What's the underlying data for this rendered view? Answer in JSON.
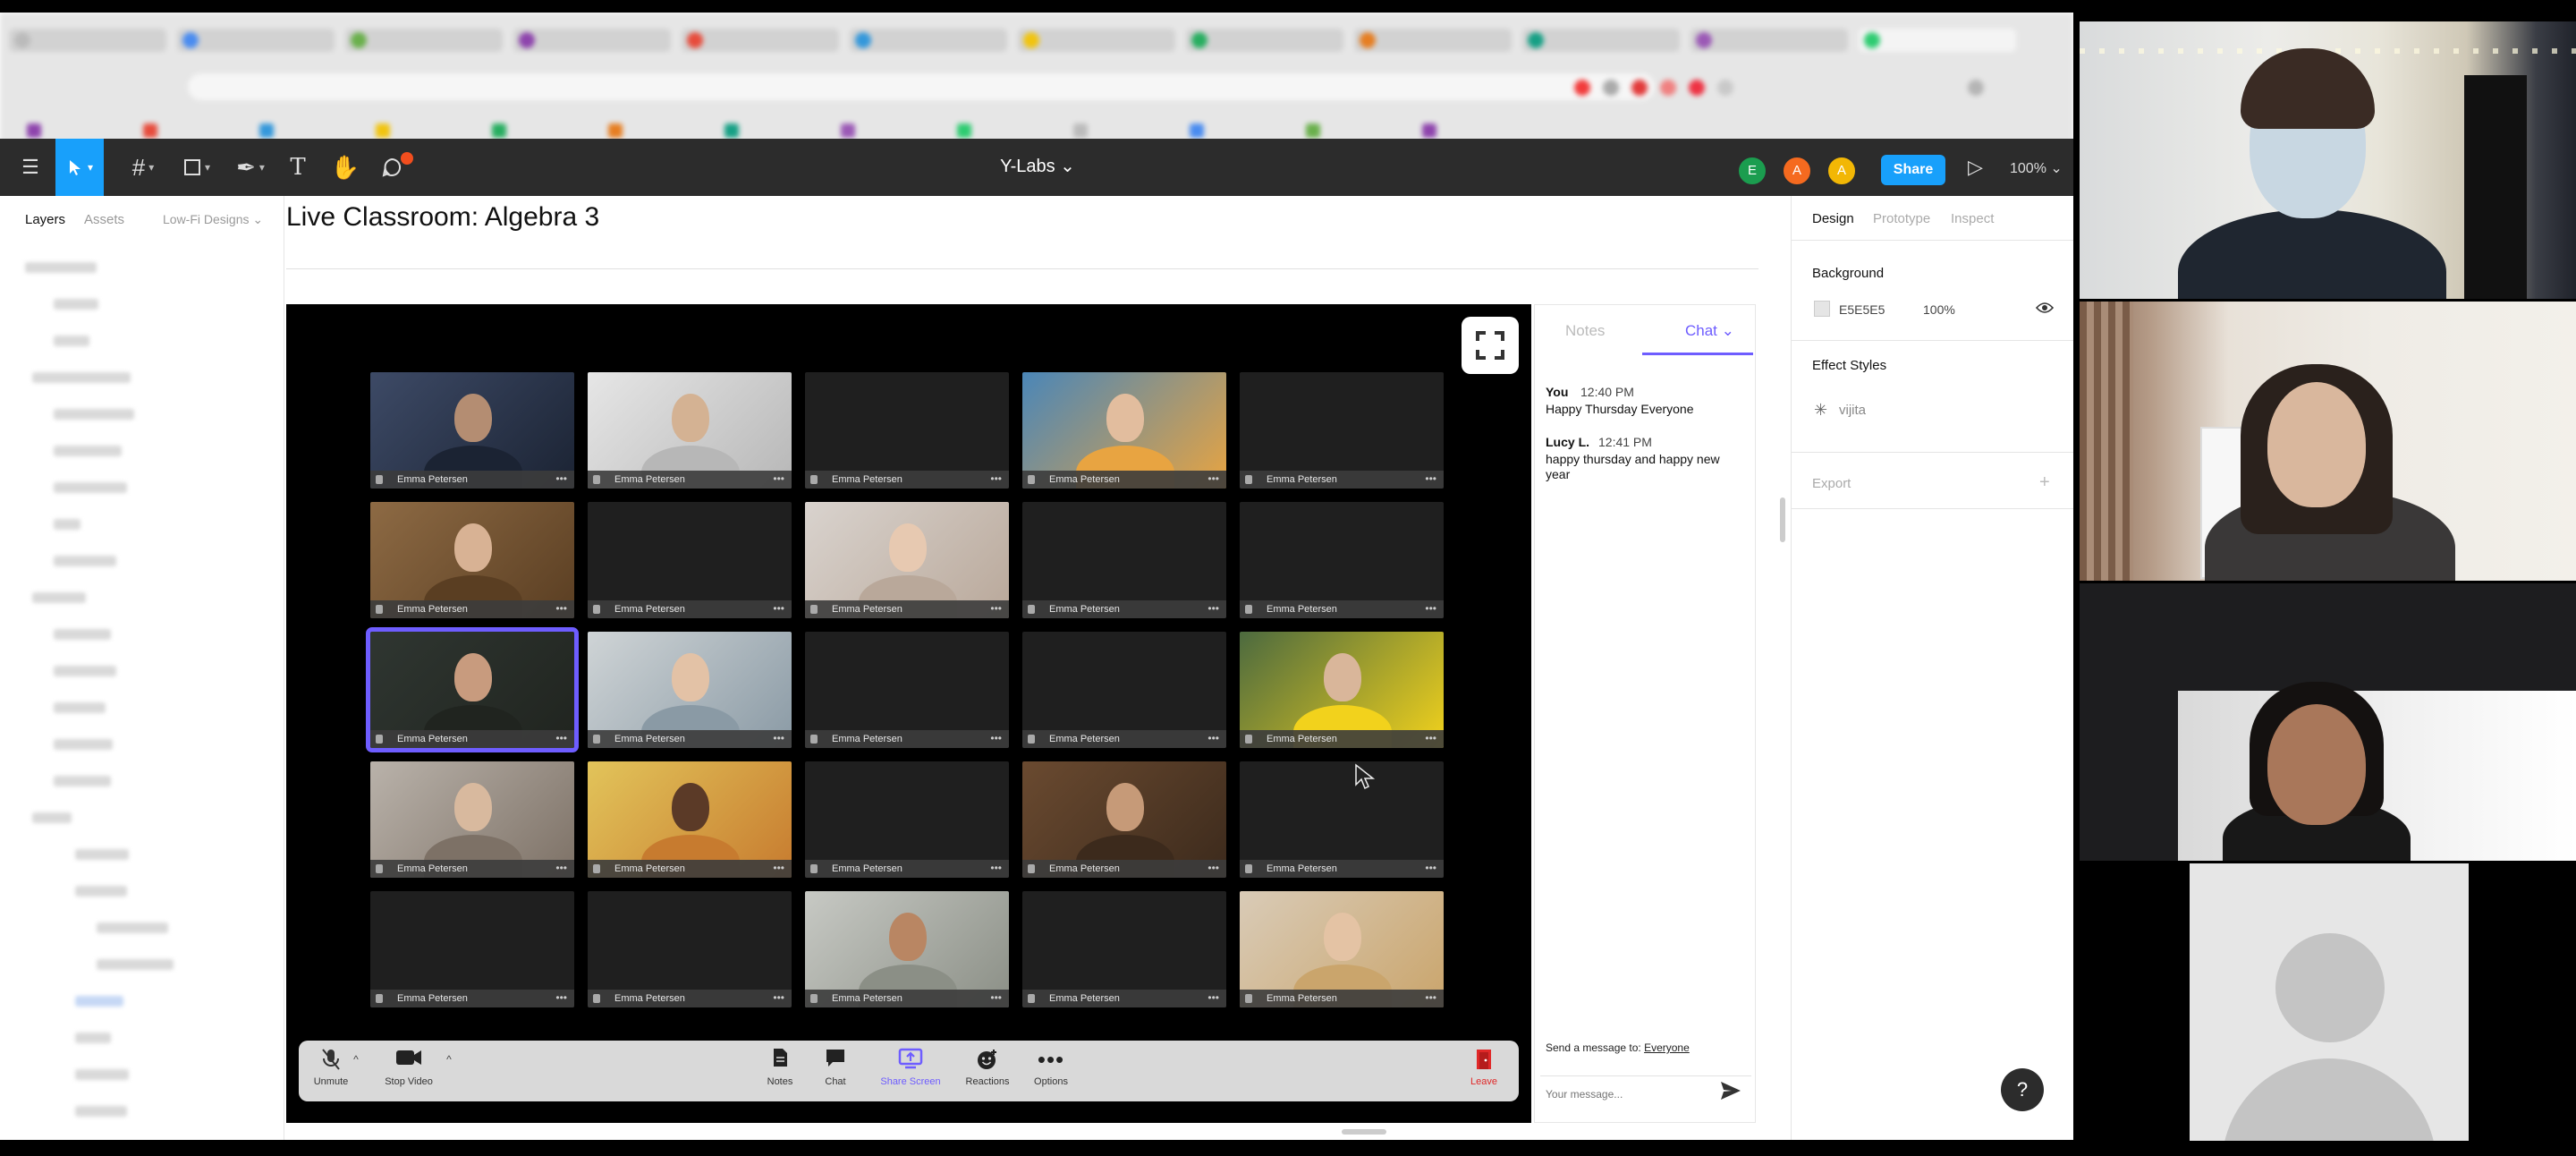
{
  "browser": {
    "tabs": [
      "",
      "",
      "",
      "",
      "",
      "",
      "",
      "",
      "",
      "",
      "",
      ""
    ],
    "bookmarks": [
      "",
      "",
      "",
      "",
      "",
      "",
      "",
      "",
      "",
      "",
      "",
      "",
      ""
    ]
  },
  "figma": {
    "file_title": "Y-Labs ⌄",
    "avatars": [
      {
        "letter": "E",
        "color": "#1b9d4f"
      },
      {
        "letter": "A",
        "color": "#f56a1f"
      },
      {
        "letter": "A",
        "color": "#f2b705"
      }
    ],
    "share_label": "Share",
    "zoom": "100% ⌄",
    "left_tabs": {
      "layers": "Layers",
      "assets": "Assets",
      "page": "Low-Fi Designs ⌄"
    }
  },
  "canvas": {
    "page_title": "Live Classroom: Algebra 3"
  },
  "gallery": {
    "participant_name": "Emma Petersen",
    "tiles": [
      {
        "label": "Emma Petersen",
        "video": true,
        "tone": "#3d4a66",
        "skin": "#b48d72",
        "bg2": "#1b2333"
      },
      {
        "label": "Emma Petersen",
        "video": true,
        "tone": "#e6e6e6",
        "skin": "#d4b293",
        "bg2": "#b7b7b7"
      },
      {
        "label": "Emma Petersen",
        "video": false
      },
      {
        "label": "Emma Petersen",
        "video": true,
        "tone": "#4a86b8",
        "skin": "#e2bd9e",
        "bg2": "#e8a441"
      },
      {
        "label": "Emma Petersen",
        "video": false
      },
      {
        "label": "Emma Petersen",
        "video": true,
        "tone": "#8d6a44",
        "skin": "#d8b294",
        "bg2": "#5a3e22"
      },
      {
        "label": "Emma Petersen",
        "video": false
      },
      {
        "label": "Emma Petersen",
        "video": true,
        "tone": "#d9d3ce",
        "skin": "#e7c9b1",
        "bg2": "#b9a89a"
      },
      {
        "label": "Emma Petersen",
        "video": false
      },
      {
        "label": "Emma Petersen",
        "video": false
      },
      {
        "label": "Emma Petersen",
        "video": true,
        "tone": "#2f3631",
        "skin": "#c89b7e",
        "bg2": "#20241f",
        "active": true
      },
      {
        "label": "Emma Petersen",
        "video": true,
        "tone": "#cfd4d6",
        "skin": "#e3c2a6",
        "bg2": "#8a9aa5"
      },
      {
        "label": "Emma Petersen",
        "video": false
      },
      {
        "label": "Emma Petersen",
        "video": false
      },
      {
        "label": "Emma Petersen",
        "video": true,
        "tone": "#4c6a3f",
        "skin": "#d9b69a",
        "bg2": "#f2d21c"
      },
      {
        "label": "Emma Petersen",
        "video": true,
        "tone": "#b9b2aa",
        "skin": "#d8b99e",
        "bg2": "#7d7166"
      },
      {
        "label": "Emma Petersen",
        "video": true,
        "tone": "#e2c45a",
        "skin": "#5b3a27",
        "bg2": "#c77b2f"
      },
      {
        "label": "Emma Petersen",
        "video": false
      },
      {
        "label": "Emma Petersen",
        "video": true,
        "tone": "#6a4a30",
        "skin": "#c69a78",
        "bg2": "#3c2a1c"
      },
      {
        "label": "Emma Petersen",
        "video": false
      },
      {
        "label": "Emma Petersen",
        "video": false
      },
      {
        "label": "Emma Petersen",
        "video": false
      },
      {
        "label": "Emma Petersen",
        "video": true,
        "tone": "#c7c9c4",
        "skin": "#b98663",
        "bg2": "#8b8f86"
      },
      {
        "label": "Emma Petersen",
        "video": false
      },
      {
        "label": "Emma Petersen",
        "video": true,
        "tone": "#d9cbb7",
        "skin": "#e4c3a4",
        "bg2": "#caa56c"
      }
    ]
  },
  "controls": {
    "unmute": "Unmute",
    "stop_video": "Stop Video",
    "notes": "Notes",
    "chat": "Chat",
    "share_screen": "Share Screen",
    "reactions": "Reactions",
    "options": "Options",
    "leave": "Leave"
  },
  "chat": {
    "tab_notes": "Notes",
    "tab_chat": "Chat ⌄",
    "messages": [
      {
        "from": "You",
        "time": "12:40 PM",
        "text": "Happy Thursday Everyone"
      },
      {
        "from": "Lucy L.",
        "time": "12:41 PM",
        "text": "happy thursday and happy new year"
      }
    ],
    "send_to_prefix": "Send a message to:",
    "send_to_target": "Everyone",
    "input_placeholder": "Your message..."
  },
  "design_panel": {
    "tabs": {
      "design": "Design",
      "prototype": "Prototype",
      "inspect": "Inspect"
    },
    "background_label": "Background",
    "background_hex": "E5E5E5",
    "background_opacity": "100%",
    "effect_styles_label": "Effect Styles",
    "effect_name": "vijita",
    "export_label": "Export",
    "export_add": "+",
    "help": "?"
  },
  "colors": {
    "accent": "#18a0fb",
    "zoom_accent": "#6e5dff",
    "leave_red": "#e02828"
  },
  "webcams": [
    {
      "kind": "video"
    },
    {
      "kind": "video"
    },
    {
      "kind": "video"
    },
    {
      "kind": "avatar-placeholder"
    }
  ]
}
